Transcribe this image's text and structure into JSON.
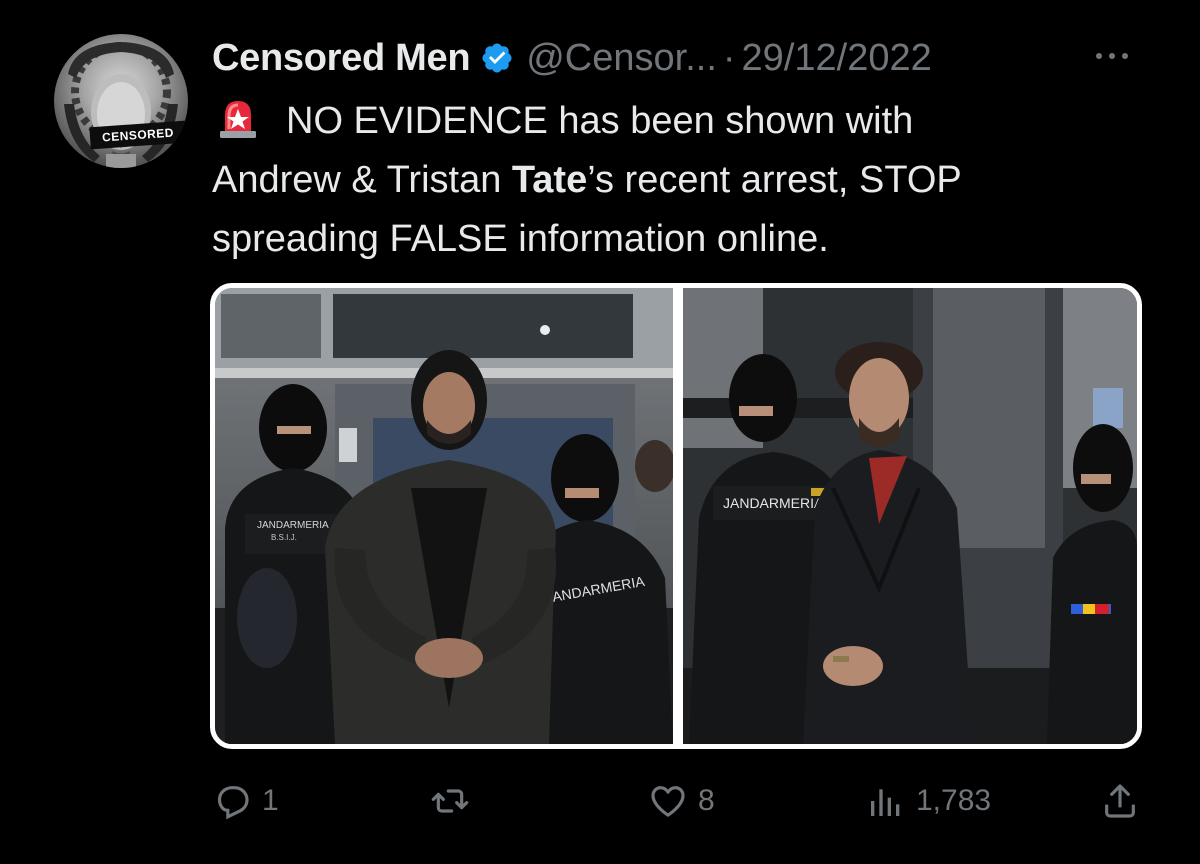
{
  "tweet": {
    "display_name": "Censored Men",
    "verified": true,
    "handle": "@Censor...",
    "separator": "·",
    "date": "29/12/2022",
    "avatar_badge": "CENSORED",
    "text": {
      "emoji": "rotating-light-icon",
      "line1": "NO EVIDENCE has been shown with",
      "line2_before": "Andrew & Tristan ",
      "line2_bold": "Tate",
      "line2_after": "’s recent arrest, STOP",
      "line3": "spreading FALSE information online."
    },
    "media": {
      "left_vest_text": "JANDARMERIA",
      "left_vest_sub": "B.S.I.J.",
      "left_vest_text_2": "JANDARMERIA",
      "right_vest_text": "JANDARMERIA"
    },
    "actions": {
      "reply_count": "1",
      "retweet_count": "",
      "like_count": "8",
      "view_count": "1,783"
    }
  },
  "colors": {
    "background": "#000000",
    "primary_text": "#e7e9ea",
    "secondary_text": "#71767b",
    "verified_blue": "#1d9bf0"
  }
}
